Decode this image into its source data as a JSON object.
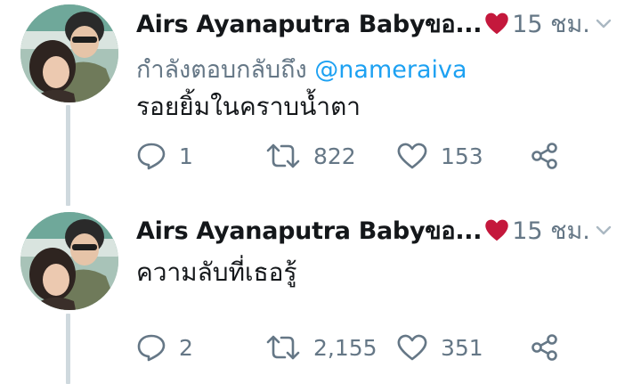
{
  "colors": {
    "text": "#14171a",
    "secondary": "#657786",
    "link": "#1da1f2",
    "thread_line": "#cfd9de",
    "emoji_heart": "#c4183c"
  },
  "tweets": [
    {
      "author_name": "Airs Ayanaputra Babyขอ...",
      "name_emoji": "red-heart-emoji",
      "timestamp": "15 ชม.",
      "reply_prefix": "กำลังตอบกลับถึง",
      "reply_mention": "@nameraiva",
      "text": "รอยยิ้มในคราบน้ำตา",
      "reply_count": "1",
      "retweet_count": "822",
      "like_count": "153"
    },
    {
      "author_name": "Airs Ayanaputra Babyขอ...",
      "name_emoji": "red-heart-emoji",
      "timestamp": "15 ชม.",
      "text": "ความลับที่เธอรู้",
      "reply_count": "2",
      "retweet_count": "2,155",
      "like_count": "351"
    }
  ],
  "icons": {
    "reply": "reply-icon",
    "retweet": "retweet-icon",
    "like": "like-icon",
    "share": "share-icon",
    "more": "chevron-down-icon"
  }
}
